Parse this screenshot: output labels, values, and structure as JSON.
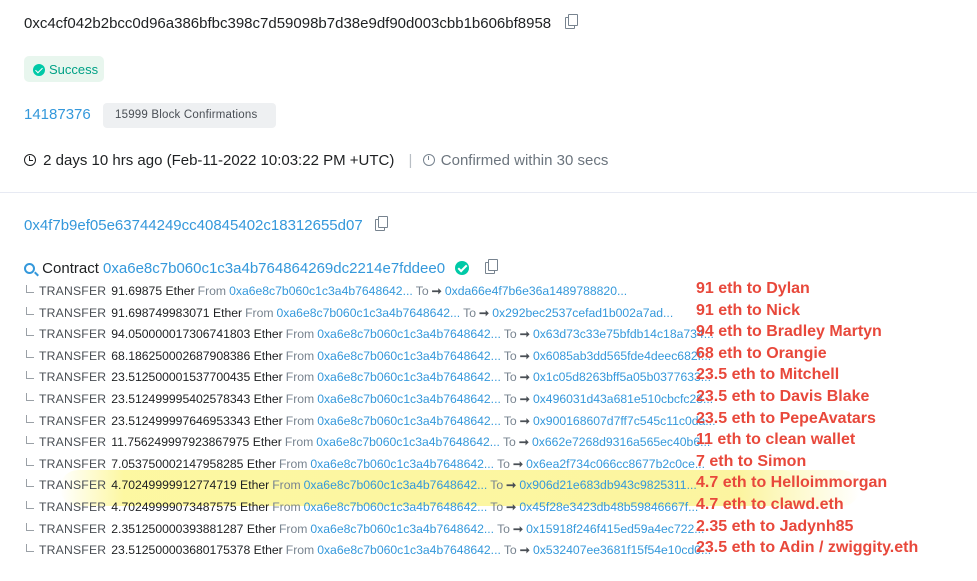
{
  "tx_hash": "0xc4cf042b2bcc0d96a386bfbc398c7d59098b7d38e9df90d003cbb1b606bf8958",
  "status": "Success",
  "block": {
    "number": "14187376",
    "confirmations": "15999 Block Confirmations"
  },
  "timestamp": {
    "text": "2 days 10 hrs ago (Feb-11-2022 10:03:22 PM +UTC)",
    "separator": "|",
    "confirmed": "Confirmed within 30 secs"
  },
  "from_address": "0x4f7b9ef05e63744249cc40845402c18312655d07",
  "contract": {
    "label": "Contract",
    "address": "0xa6e8c7b060c1c3a4b764864269dc2214e7fddee0"
  },
  "labels": {
    "transfer": "TRANSFER",
    "from": "From",
    "to": "To",
    "arrow": "➞"
  },
  "transfers": [
    {
      "amount": "91.69875 Ether",
      "from": "0xa6e8c7b060c1c3a4b7648642...",
      "to": "0xda66e4f7b6e36a1489788820..."
    },
    {
      "amount": "91.698749983071 Ether",
      "from": "0xa6e8c7b060c1c3a4b7648642...",
      "to": "0x292bec2537cefad1b002a7ad..."
    },
    {
      "amount": "94.050000017306741803 Ether",
      "from": "0xa6e8c7b060c1c3a4b7648642...",
      "to": "0x63d73c33e75bfdb14c18a734..."
    },
    {
      "amount": "68.186250002687908386 Ether",
      "from": "0xa6e8c7b060c1c3a4b7648642...",
      "to": "0x6085ab3dd565fde4deec682f..."
    },
    {
      "amount": "23.512500001537700435 Ether",
      "from": "0xa6e8c7b060c1c3a4b7648642...",
      "to": "0x1c05d8263bff5a05b0377633..."
    },
    {
      "amount": "23.512499995402578343 Ether",
      "from": "0xa6e8c7b060c1c3a4b7648642...",
      "to": "0x496031d43a681e510cbcfc28..."
    },
    {
      "amount": "23.512499997646953343 Ether",
      "from": "0xa6e8c7b060c1c3a4b7648642...",
      "to": "0x900168607d7ff7c545c11c0da..."
    },
    {
      "amount": "11.756249997923867975 Ether",
      "from": "0xa6e8c7b060c1c3a4b7648642...",
      "to": "0x662e7268d9316a565ec40b6..."
    },
    {
      "amount": "7.053750002147958285 Ether",
      "from": "0xa6e8c7b060c1c3a4b7648642...",
      "to": "0x6ea2f734c066cc8677b2c0ce..."
    },
    {
      "amount": "4.70249999912774719 Ether",
      "from": "0xa6e8c7b060c1c3a4b7648642...",
      "to": "0x906d21e683db943c9825311..."
    },
    {
      "amount": "4.70249999073487575 Ether",
      "from": "0xa6e8c7b060c1c3a4b7648642...",
      "to": "0x45f28e3423db48b59846667f..."
    },
    {
      "amount": "2.351250000393881287 Ether",
      "from": "0xa6e8c7b060c1c3a4b7648642...",
      "to": "0x15918f246f415ed59a4ec722..."
    },
    {
      "amount": "23.512500003680175378 Ether",
      "from": "0xa6e8c7b060c1c3a4b7648642...",
      "to": "0x532407ee3681f15f54e10cd0..."
    }
  ],
  "annotations": [
    "91 eth to Dylan",
    "91 eth to Nick",
    "94 eth to Bradley Martyn",
    "68 eth to Orangie",
    "23.5 eth to Mitchell",
    "23.5 eth to Davis Blake",
    "23.5 eth to PepeAvatars",
    "11 eth to clean wallet",
    "7 eth to Simon",
    "4.7 eth to Helloimmorgan",
    "4.7 eth to clawd.eth",
    "2.35 eth to Jadynh85",
    "23.5 eth to Adin / zwiggity.eth"
  ],
  "colors": {
    "link": "#3498db",
    "success": "#00a186",
    "annotation": "#e8483b",
    "highlight": "#fcf582"
  }
}
